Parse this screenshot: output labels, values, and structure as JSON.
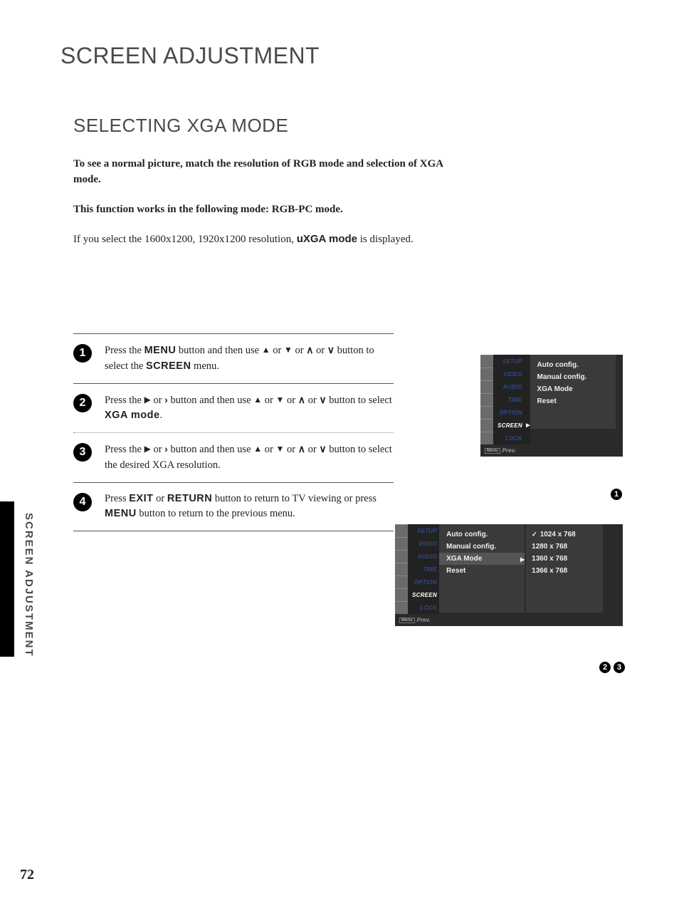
{
  "page": {
    "title": "SCREEN ADJUSTMENT",
    "subtitle": "SELECTING XGA MODE",
    "side_label": "SCREEN ADJUSTMENT",
    "page_number": "72"
  },
  "intro": {
    "p1": "To see a normal picture, match the resolution of RGB mode and selection of XGA mode.",
    "p2": "This function works in the following mode: RGB-PC mode.",
    "p3a": "If you select the 1600x1200, 1920x1200 resolution, ",
    "p3b": "uXGA mode",
    "p3c": " is displayed."
  },
  "steps": {
    "s1": {
      "num": "1",
      "a": "Press the ",
      "b": "MENU",
      "c": " button and then use ",
      "d": " or ",
      "e": "  or  ",
      "f": " or  ",
      "g": "  button to select the ",
      "h": "SCREEN",
      "i": " menu."
    },
    "s2": {
      "num": "2",
      "a": "Press the ",
      "b": "  or  ",
      "c": "  button and then use ",
      "d": " or ",
      "e": "  or  ",
      "f": " or  ",
      "g": "  button to select ",
      "h": "XGA mode",
      "i": "."
    },
    "s3": {
      "num": "3",
      "a": "Press the ",
      "b": "  or  ",
      "c": "  button and then use ",
      "d": " or ",
      "e": "  or  ",
      "f": " or  ",
      "g": "  button to select the desired XGA resolution."
    },
    "s4": {
      "num": "4",
      "a": "Press ",
      "b": "EXIT",
      "c": " or ",
      "d": "RETURN",
      "e": " button to return to TV viewing or press ",
      "f": "MENU",
      "g": " button to return to the previous menu."
    }
  },
  "osd": {
    "tabs": [
      "SETUP",
      "VIDEO",
      "AUDIO",
      "TIME",
      "OPTION",
      "SCREEN",
      "LOCK"
    ],
    "submenu": {
      "items": [
        "Auto config.",
        "Manual config.",
        "XGA Mode",
        "Reset"
      ]
    },
    "resolutions": [
      "1024 x 768",
      "1280 x 768",
      "1360 x 768",
      "1366 x 768"
    ],
    "prev": "Prev.",
    "menu_box": "Menu"
  },
  "refs": {
    "r1": "1",
    "r2": "2",
    "r3": "3"
  }
}
